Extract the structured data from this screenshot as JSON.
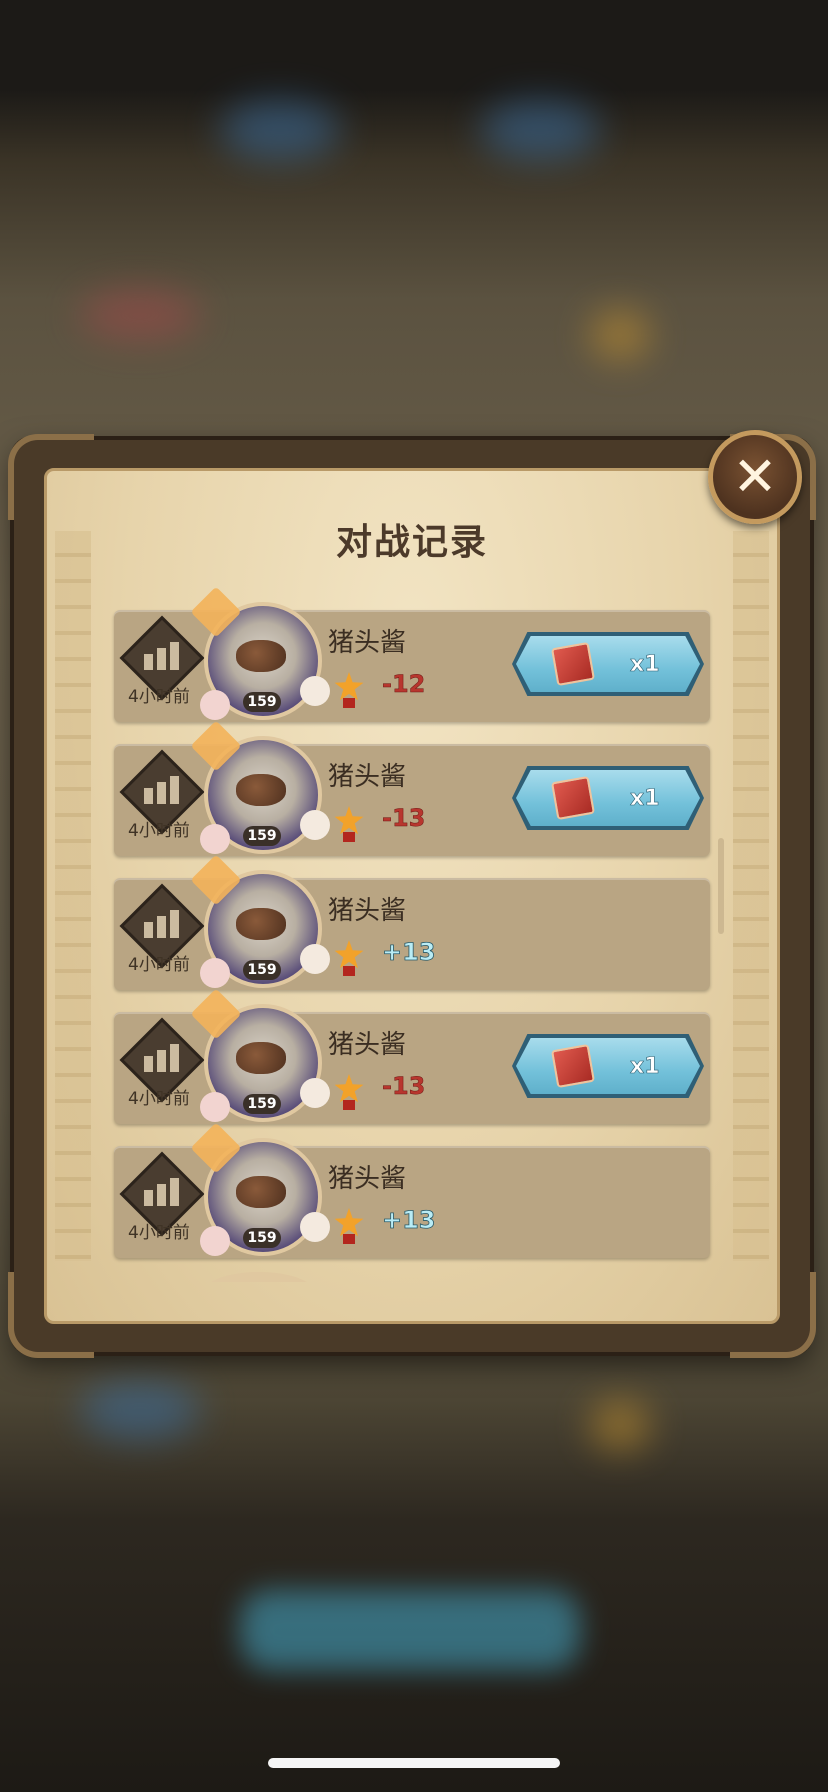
{
  "dialog": {
    "title": "对战记录",
    "close_icon": "close-icon"
  },
  "records": [
    {
      "time": "4小时前",
      "name": "猪头酱",
      "level": "159",
      "score": "-12",
      "score_sign": "neg",
      "reward": "x1",
      "has_reward": true
    },
    {
      "time": "4小时前",
      "name": "猪头酱",
      "level": "159",
      "score": "-13",
      "score_sign": "neg",
      "reward": "x1",
      "has_reward": true
    },
    {
      "time": "4小时前",
      "name": "猪头酱",
      "level": "159",
      "score": "+13",
      "score_sign": "pos",
      "reward": "",
      "has_reward": false
    },
    {
      "time": "4小时前",
      "name": "猪头酱",
      "level": "159",
      "score": "-13",
      "score_sign": "neg",
      "reward": "x1",
      "has_reward": true
    },
    {
      "time": "4小时前",
      "name": "猪头酱",
      "level": "159",
      "score": "+13",
      "score_sign": "pos",
      "reward": "",
      "has_reward": false
    }
  ],
  "colors": {
    "negative_score": "#b8362e",
    "positive_score": "#b9ecf5",
    "reward_button": "#73c1da",
    "panel_bg": "#e7d4ab"
  }
}
